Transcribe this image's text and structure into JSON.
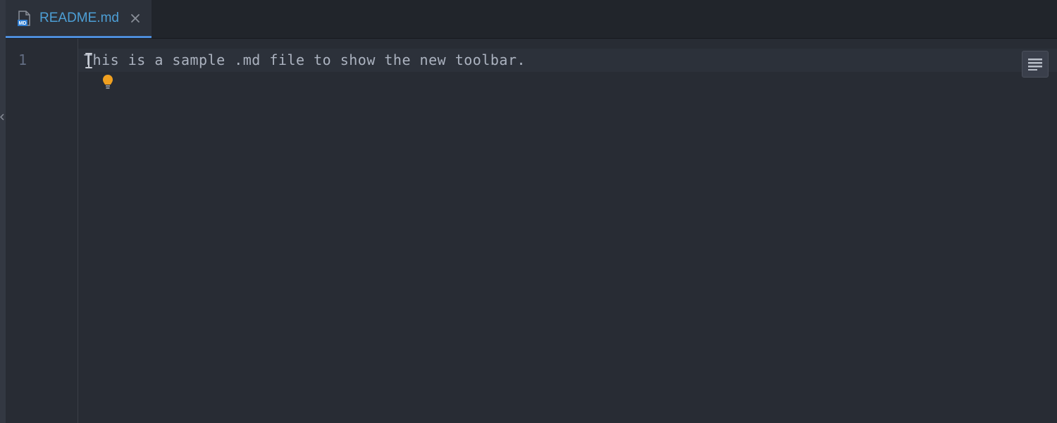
{
  "tab": {
    "filename": "README.md",
    "icon_badge": "MD",
    "active": true
  },
  "editor": {
    "lines": [
      {
        "number": "1",
        "text": "This is a sample .md file to show the new toolbar."
      }
    ],
    "cursor_line": 1,
    "cursor_col": 1
  },
  "hints": {
    "bulb_icon": "lightbulb-icon"
  },
  "toolbar": {
    "menu_icon": "menu-icon"
  }
}
